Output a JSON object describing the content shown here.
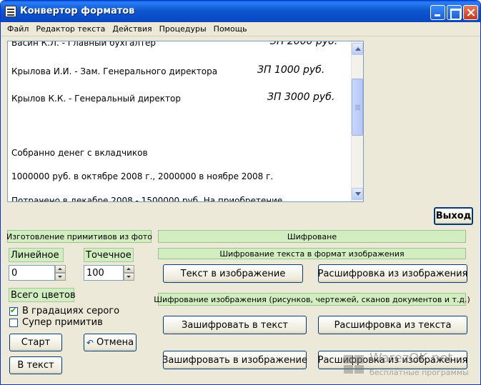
{
  "window": {
    "title": "Конвертор форматов"
  },
  "menu": [
    "Файл",
    "Редактор текста",
    "Действия",
    "Процедуры",
    "Помощь"
  ],
  "document": {
    "lines": [
      {
        "text": "Васин К.Л.  - Главный бухгалтер",
        "salary": "ЗП 2000 руб."
      },
      {
        "text": "Крылова И.И.  - Зам. Генерального директора",
        "salary": "ЗП 1000 руб."
      },
      {
        "text": "Крылов К.К.   - Генеральный директор",
        "salary": "ЗП 3000 руб."
      },
      {
        "text": "Собранно денег с вкладчиков",
        "salary": ""
      },
      {
        "text": "1000000 руб. в  октябре 2008 г., 2000000 в ноябре 2008 г.",
        "salary": ""
      },
      {
        "text": "Потрачено в декабре 2008 - 1500000 руб. На приобретение",
        "salary": ""
      }
    ]
  },
  "buttons": {
    "exit": "Выход",
    "start": "Старт",
    "cancel": "Отмена",
    "to_text": "В текст",
    "text_to_image": "Текст в изображение",
    "decode_from_image": "Расшифровка из изображения",
    "encrypt_to_text": "Зашифровать в текст",
    "decode_from_text": "Расшифровка из текста",
    "encrypt_to_image": "Зашифровать в  изображение",
    "decode_from_image_2": "Расшифровка из изображения"
  },
  "primitives_panel": {
    "header": "Изготовление примитивов из фото",
    "linear_label": "Линейное",
    "linear_value": "0",
    "point_label": "Точечное",
    "point_value": "100",
    "colors_label": "Всего цветов",
    "grayscale_label": "В градациях серого",
    "grayscale_checked": true,
    "super_label": "Супер примитив",
    "super_checked": false
  },
  "encryption_panel": {
    "header": "Шифроване",
    "text_sub_header": "Шифрование текста в формат изображения",
    "image_sub_header": "Шифрование изображения (рисунков, чертежей, сканов документов и т.д.)"
  },
  "watermark": {
    "title": "WarezOK.net",
    "subtitle": "бесплатные программы"
  },
  "icons": {
    "app": "document-icon",
    "cancel": "undo-arrow-icon"
  }
}
